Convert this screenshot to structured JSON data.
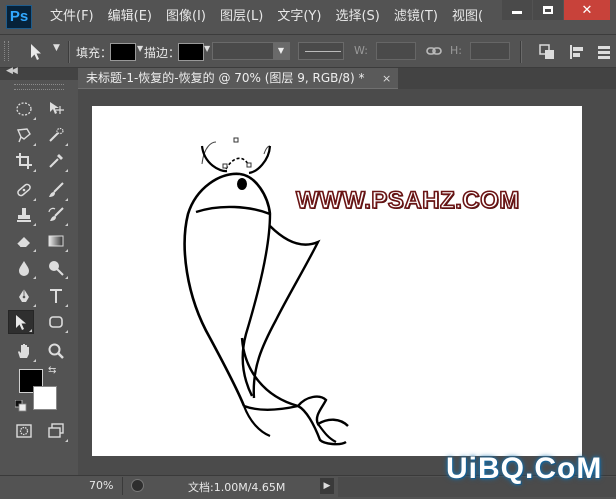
{
  "app": {
    "logo_text": "Ps",
    "menu": [
      "文件(F)",
      "编辑(E)",
      "图像(I)",
      "图层(L)",
      "文字(Y)",
      "选择(S)",
      "滤镜(T)",
      "视图("
    ],
    "window_controls": [
      "minimize",
      "maximize",
      "close"
    ]
  },
  "options_bar": {
    "fill_label": "填充：",
    "stroke_label": "描边：",
    "fill_color": "#000000",
    "stroke_color": "#000000",
    "width_label": "W:",
    "height_label": "H:"
  },
  "document": {
    "tab_title": "未标题-1-恢复的-恢复的 @ 70% (图层 9, RGB/8) *",
    "tab_close": "×",
    "watermark_text": "WWW.PSAHZ.COM",
    "watermark_color": "#6a1414"
  },
  "toolbox": {
    "tools": [
      "rectangular-marquee-icon",
      "move-icon",
      "lasso-icon",
      "quick-selection-icon",
      "crop-icon",
      "eyedropper-icon",
      "healing-brush-icon",
      "brush-icon",
      "clone-stamp-icon",
      "history-brush-icon",
      "eraser-icon",
      "gradient-icon",
      "blur-icon",
      "dodge-icon",
      "pen-icon",
      "type-icon",
      "path-selection-icon",
      "shape-icon",
      "hand-icon",
      "zoom-icon",
      "quick-mask-icon",
      "screen-mode-icon"
    ],
    "active_tool": "path-selection-icon",
    "foreground_color": "#000000",
    "background_color": "#ffffff"
  },
  "status_bar": {
    "zoom": "70%",
    "doc_info": "文档:1.00M/4.65M",
    "arrow": "▶"
  },
  "branding": {
    "site_logo": "UiBQ.CoM",
    "glow_color": "#1a6fa8"
  }
}
